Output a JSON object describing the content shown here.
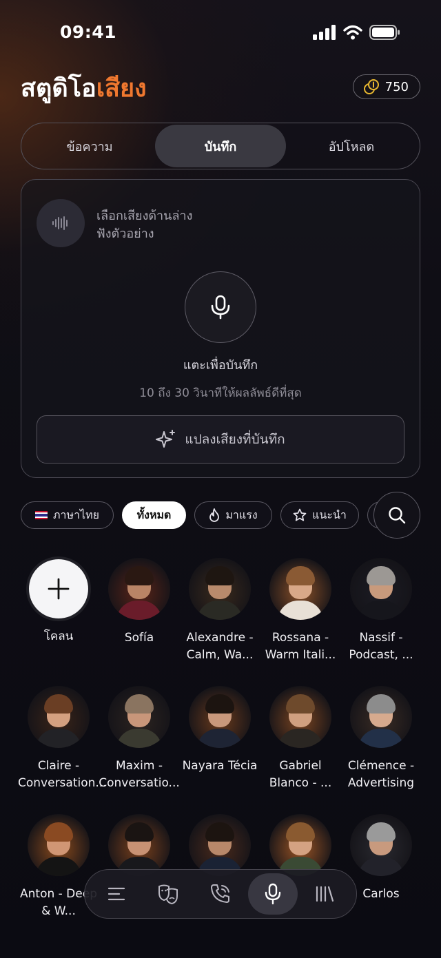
{
  "status": {
    "time": "09:41"
  },
  "header": {
    "title_part1": "สตูดิโอ",
    "title_accent": "เสียง",
    "credits": "750",
    "accent_color": "#f0782f"
  },
  "tabs": [
    {
      "label": "ข้อความ",
      "active": false
    },
    {
      "label": "บันทึก",
      "active": true
    },
    {
      "label": "อัปโหลด",
      "active": false
    }
  ],
  "recorder": {
    "hint_line1": "เลือกเสียงด้านล่าง",
    "hint_line2": "ฟังตัวอย่าง",
    "tap_label": "แตะเพื่อบันทึก",
    "tip": "10 ถึง 30 วินาทีให้ผลลัพธ์ดีที่สุด",
    "convert_label": "แปลงเสียงที่บันทึก"
  },
  "filters": {
    "language": "ภาษาไทย",
    "all": "ทั้งหมด",
    "trending": "มาแรง",
    "recommended": "แนะนำ"
  },
  "voices": {
    "clone_label": "โคลน",
    "items": [
      {
        "name": "Sofía",
        "skin": "#b98466",
        "hair": "#2a1812",
        "outfit": "#6a1c2a",
        "glow": "#5a2418"
      },
      {
        "name": "Alexandre - Calm, Wa...",
        "skin": "#b88a6c",
        "hair": "#1e1611",
        "outfit": "#2a2a24",
        "glow": "#3a2a1c"
      },
      {
        "name": "Rossana - Warm Itali...",
        "skin": "#d8a888",
        "hair": "#8a5a34",
        "outfit": "#e8e0d6",
        "glow": "#8a5028"
      },
      {
        "name": "Nassif - Podcast, ...",
        "skin": "#c89a7c",
        "hair": "#9c9894",
        "outfit": "#16161c",
        "glow": "#1c1c24"
      },
      {
        "name": "Claire - Conversation...",
        "skin": "#d4a080",
        "hair": "#6a3e24",
        "outfit": "#222226",
        "glow": "#3a2418"
      },
      {
        "name": "Maxim - Conversatio...",
        "skin": "#c8967a",
        "hair": "#8a7460",
        "outfit": "#3a3a30",
        "glow": "#2c2420"
      },
      {
        "name": "Nayara Técia",
        "skin": "#c8987c",
        "hair": "#1c1410",
        "outfit": "#1e2434",
        "glow": "#6a3a1c"
      },
      {
        "name": "Gabriel Blanco - ...",
        "skin": "#d0a080",
        "hair": "#6e4a2c",
        "outfit": "#2a2622",
        "glow": "#7a4420"
      },
      {
        "name": "Clémence - Advertising",
        "skin": "#d6aa8e",
        "hair": "#8c8c8c",
        "outfit": "#223048",
        "glow": "#3a2c24"
      },
      {
        "name": "Anton - Deep & W...",
        "skin": "#d09674",
        "hair": "#8a4a22",
        "outfit": "#141414",
        "glow": "#8a4a1c"
      },
      {
        "name": "",
        "skin": "#c89274",
        "hair": "#1a1412",
        "outfit": "#18181c",
        "glow": "#7a401c"
      },
      {
        "name": "",
        "skin": "#b8886a",
        "hair": "#1c1410",
        "outfit": "#1a2234",
        "glow": "#4a2a1c"
      },
      {
        "name": "",
        "skin": "#d4a282",
        "hair": "#8a5a30",
        "outfit": "#3a4a34",
        "glow": "#9a5424"
      },
      {
        "name": "Carlos",
        "skin": "#c89a7e",
        "hair": "#9a9a9a",
        "outfit": "#22222a",
        "glow": "#2a2a30"
      }
    ]
  },
  "nav": {
    "items": [
      "menu-icon",
      "masks-icon",
      "phone-call-icon",
      "microphone-icon",
      "library-icon"
    ],
    "active": "microphone-icon"
  }
}
